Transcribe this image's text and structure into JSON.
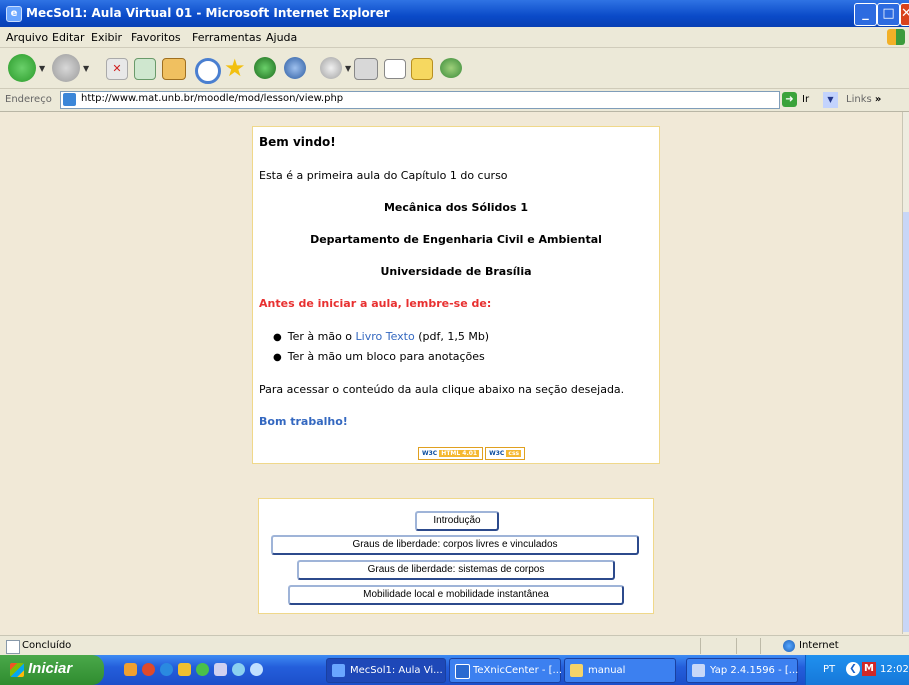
{
  "window": {
    "title": "MecSol1: Aula Virtual 01 - Microsoft Internet Explorer"
  },
  "menu": [
    "Arquivo",
    "Editar",
    "Exibir",
    "Favoritos",
    "Ferramentas",
    "Ajuda"
  ],
  "address": {
    "label": "Endereço",
    "url": "http://www.mat.unb.br/moodle/mod/lesson/view.php",
    "go_label": "Ir",
    "links_label": "Links"
  },
  "page": {
    "welcome": "Bem vindo!",
    "intro": "Esta é a primeira aula do Capítulo 1 do curso",
    "course_name": "Mecânica dos Sólidos 1",
    "department": "Departamento de Engenharia Civil e Ambiental",
    "university": "Universidade de Brasília",
    "warning": "Antes de iniciar a aula, lembre-se de:",
    "bullet1_prefix": "Ter à mão o",
    "bullet1_link": "Livro Texto",
    "bullet1_suffix": "(pdf, 1,5 Mb)",
    "bullet2": "Ter à mão um bloco para anotações",
    "access_text": "Para acessar o conteúdo da aula clique abaixo na seção desejada.",
    "good_work": "Bom trabalho!",
    "badges": {
      "html_w3c": "W3C",
      "html_label": "HTML 4.01",
      "css_w3c": "W3C",
      "css_label": "css"
    }
  },
  "nav_buttons": [
    "Introdução",
    "Graus de liberdade: corpos livres e vinculados",
    "Graus de liberdade: sistemas de corpos",
    "Mobilidade local e mobilidade instantânea"
  ],
  "status": {
    "text": "Concluído",
    "zone": "Internet"
  },
  "taskbar": {
    "start": "Iniciar",
    "tasks": [
      "MecSol1: Aula Vi...",
      "TeXnicCenter - [...",
      "manual",
      "Yap 2.4.1596 - [..."
    ],
    "lang": "PT",
    "clock": "12:02"
  }
}
